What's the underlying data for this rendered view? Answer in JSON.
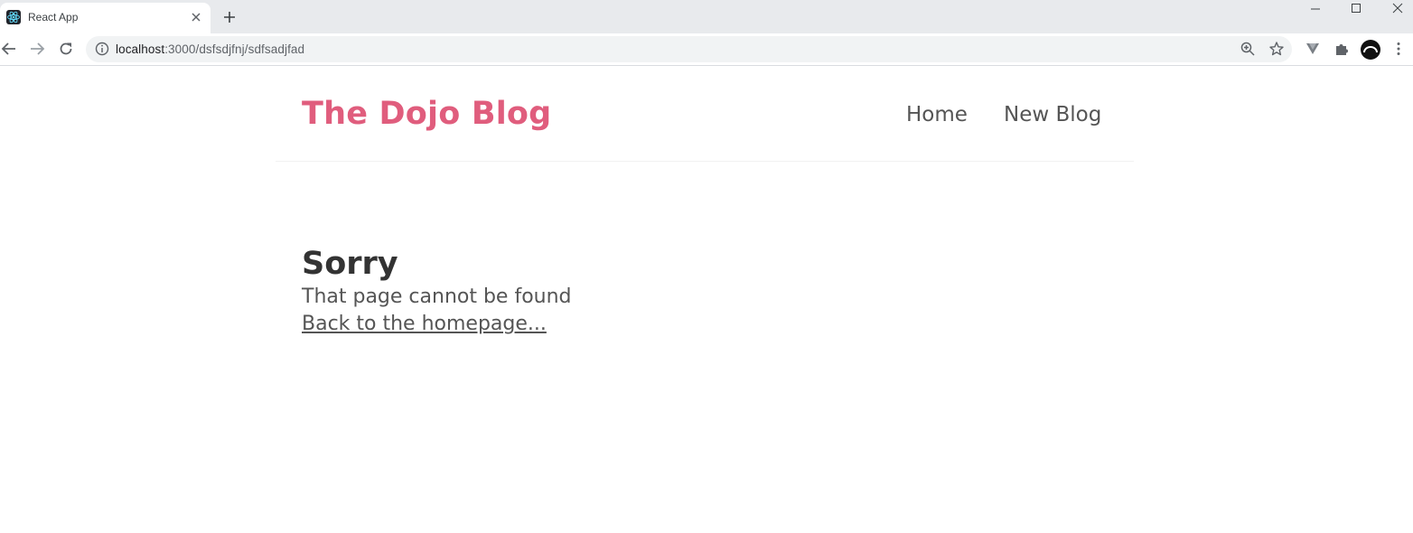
{
  "browser": {
    "tab_title": "React App",
    "url_host": "localhost",
    "url_rest": ":3000/dsfsdjfnj/sdfsadjfad"
  },
  "site": {
    "brand": "The Dojo Blog",
    "nav": [
      {
        "label": "Home"
      },
      {
        "label": "New Blog"
      }
    ]
  },
  "not_found": {
    "heading": "Sorry",
    "message": "That page cannot be found",
    "link_text": "Back to the homepage..."
  },
  "colors": {
    "brand": "#e05d7d",
    "text_dark": "#333333",
    "text_muted": "#555555"
  },
  "icons": [
    "react-favicon",
    "close-icon",
    "plus-icon",
    "minimize-icon",
    "maximize-icon",
    "window-close-icon",
    "back-arrow-icon",
    "forward-arrow-icon",
    "reload-icon",
    "info-icon",
    "zoom-icon",
    "star-icon",
    "extension-v-icon",
    "puzzle-icon",
    "profile-avatar",
    "kebab-menu-icon"
  ]
}
